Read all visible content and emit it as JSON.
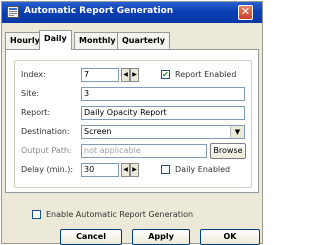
{
  "window": {
    "title": "Automatic Report Generation",
    "close_glyph": "✕"
  },
  "tabs": [
    {
      "label": "Hourly"
    },
    {
      "label": "Daily"
    },
    {
      "label": "Monthly"
    },
    {
      "label": "Quarterly"
    }
  ],
  "form": {
    "index_label": "Index:",
    "index_value": "7",
    "report_enabled_label": "Report Enabled",
    "report_enabled_checked": true,
    "site_label": "Site:",
    "site_value": "3",
    "report_label": "Report:",
    "report_value": "Daily Opacity Report",
    "destination_label": "Destination:",
    "destination_value": "Screen",
    "output_path_label": "Output Path:",
    "output_path_value": "not applicable",
    "browse_label": "Browse",
    "delay_label": "Delay (min.):",
    "delay_value": "30",
    "daily_enabled_label": "Daily Enabled",
    "daily_enabled_checked": false
  },
  "enable_auto_label": "Enable Automatic Report Generation",
  "enable_auto_checked": false,
  "buttons": {
    "cancel": "Cancel",
    "apply": "Apply",
    "ok": "OK"
  },
  "spinner": {
    "left_glyph": "◀",
    "right_glyph": "▶"
  },
  "check_glyph": "✔",
  "dropdown_glyph": "▼"
}
